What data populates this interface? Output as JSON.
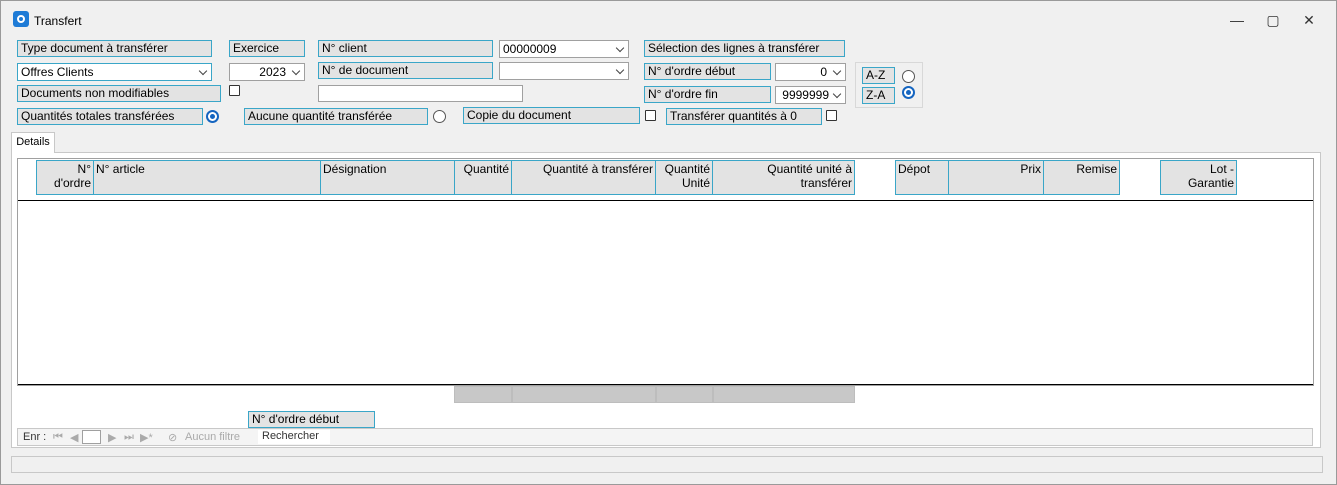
{
  "window": {
    "title": "Transfert",
    "minimize": "—",
    "maximize": "▢",
    "close": "✕"
  },
  "form": {
    "type_doc_label": "Type document à transférer",
    "type_doc_value": "Offres Clients",
    "exercice_label": "Exercice",
    "exercice_value": "2023",
    "client_label": "N° client",
    "client_value": "00000009",
    "document_label": "N° de document",
    "document_value": "",
    "selection_label": "Sélection des lignes à transférer",
    "ordre_debut_label": "N° d'ordre début",
    "ordre_debut_value": "0",
    "ordre_fin_label": "N° d'ordre fin",
    "ordre_fin_value": "9999999",
    "sort_az": "A-Z",
    "sort_za": "Z-A",
    "sort_selected": "Z-A",
    "non_modif_label": "Documents non modifiables",
    "non_modif_checked": false,
    "search_text": "",
    "qt_totales_label": "Quantités totales transférées",
    "aucune_qt_label": "Aucune quantité transférée",
    "qty_mode_selected": "totales",
    "copie_label": "Copie du document",
    "copie_checked": false,
    "transferer_zero_label": "Transférer quantités à 0",
    "transferer_zero_checked": false
  },
  "tabs": [
    {
      "label": "Details",
      "active": true
    }
  ],
  "grid": {
    "columns": [
      "N° d'ordre",
      "N° article",
      "Désignation",
      "Quantité",
      "Quantité à transférer",
      "Quantité Unité",
      "Quantité unité à transférer",
      "Dépot",
      "Prix",
      "Remise",
      "Lot - Garantie"
    ],
    "rows": []
  },
  "footer": {
    "ordre_debut_label": "N° d'ordre début"
  },
  "navigator": {
    "record_label": "Enr :",
    "record_value": "",
    "first": "⏮",
    "prev": "◀",
    "next": "▶",
    "last": "⏭",
    "new": "▶*",
    "filter_label": "Aucun filtre",
    "search_label": "Rechercher"
  }
}
